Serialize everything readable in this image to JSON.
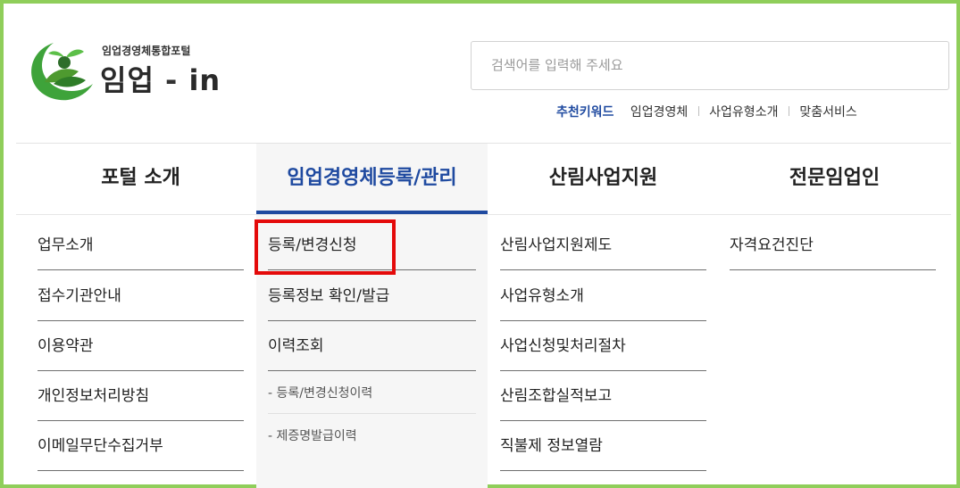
{
  "brand": {
    "subtitle": "임업경영체통합포털",
    "name_part1": "임업",
    "name_dash": "-",
    "name_part2": "in"
  },
  "search": {
    "placeholder": "검색어를 입력해 주세요"
  },
  "keywords": {
    "title": "추천키워드",
    "items": [
      "임업경영체",
      "사업유형소개",
      "맞춤서비스"
    ]
  },
  "nav": {
    "tabs": [
      {
        "label": "포털 소개"
      },
      {
        "label": "임업경영체등록/관리"
      },
      {
        "label": "산림사업지원"
      },
      {
        "label": "전문임업인"
      }
    ],
    "columns": [
      {
        "items": [
          "업무소개",
          "접수기관안내",
          "이용약관",
          "개인정보처리방침",
          "이메일무단수집거부"
        ]
      },
      {
        "items": [
          "등록/변경신청",
          "등록정보 확인/발급",
          "이력조회"
        ],
        "subitems": [
          "- 등록/변경신청이력",
          "- 제증명발급이력"
        ]
      },
      {
        "items": [
          "산림사업지원제도",
          "사업유형소개",
          "사업신청및처리절차",
          "산림조합실적보고",
          "직불제 정보열람"
        ]
      },
      {
        "items": [
          "자격요건진단"
        ]
      }
    ]
  },
  "colors": {
    "accent": "#1f4aa0",
    "frame_border": "#8fce5a",
    "highlight": "#e40a0a",
    "logo_green": "#3ea33a"
  }
}
